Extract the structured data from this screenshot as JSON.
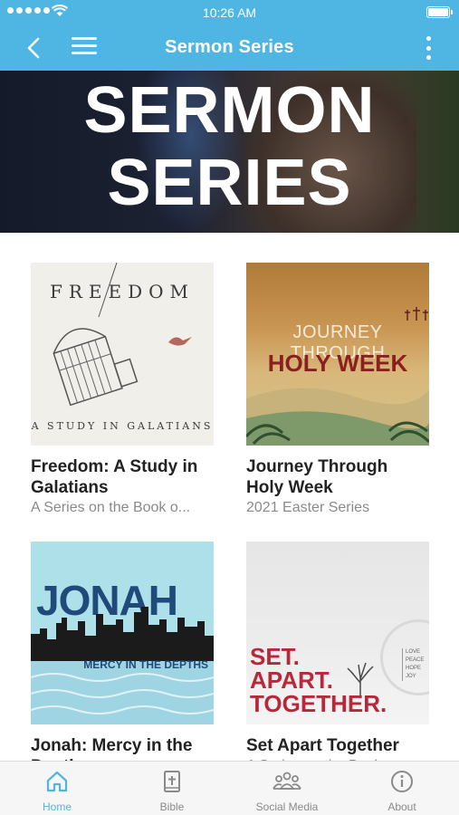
{
  "status_bar": {
    "time": "10:26 AM"
  },
  "nav": {
    "title": "Sermon Series",
    "back_icon": "chevron-left-icon",
    "menu_icon": "hamburger-menu-icon",
    "more_icon": "more-vertical-icon"
  },
  "hero": {
    "line1": "SERMON",
    "line2": "SERIES"
  },
  "cards": [
    {
      "title": "Freedom: A Study in Galatians",
      "subtitle": "A Series on the Book o...",
      "art": {
        "heading": "FREEDOM",
        "footer": "A STUDY IN GALATIANS"
      }
    },
    {
      "title": "Journey Through Holy Week",
      "subtitle": "2021 Easter Series",
      "art": {
        "line1": "JOURNEY THROUGH",
        "line2": "HOLY WEEK"
      }
    },
    {
      "title": "Jonah: Mercy in the Depths",
      "subtitle": "",
      "art": {
        "heading": "JONAH",
        "tagline": "MERCY IN THE DEPTHS"
      }
    },
    {
      "title": "Set Apart Together",
      "subtitle": "A Series on the Book",
      "art": {
        "line1": "SET.",
        "line2": "APART.",
        "line3": "TOGETHER.",
        "words": [
          "LOVE",
          "PEACE",
          "HOPE",
          "JOY"
        ]
      }
    }
  ],
  "tabs": [
    {
      "label": "Home",
      "icon": "home-icon",
      "active": true
    },
    {
      "label": "Bible",
      "icon": "bible-icon",
      "active": false
    },
    {
      "label": "Social Media",
      "icon": "people-icon",
      "active": false
    },
    {
      "label": "About",
      "icon": "info-icon",
      "active": false
    }
  ],
  "colors": {
    "accent": "#4fb6e3",
    "title_text": "#222222",
    "subtitle_text": "#8a8a8a"
  }
}
